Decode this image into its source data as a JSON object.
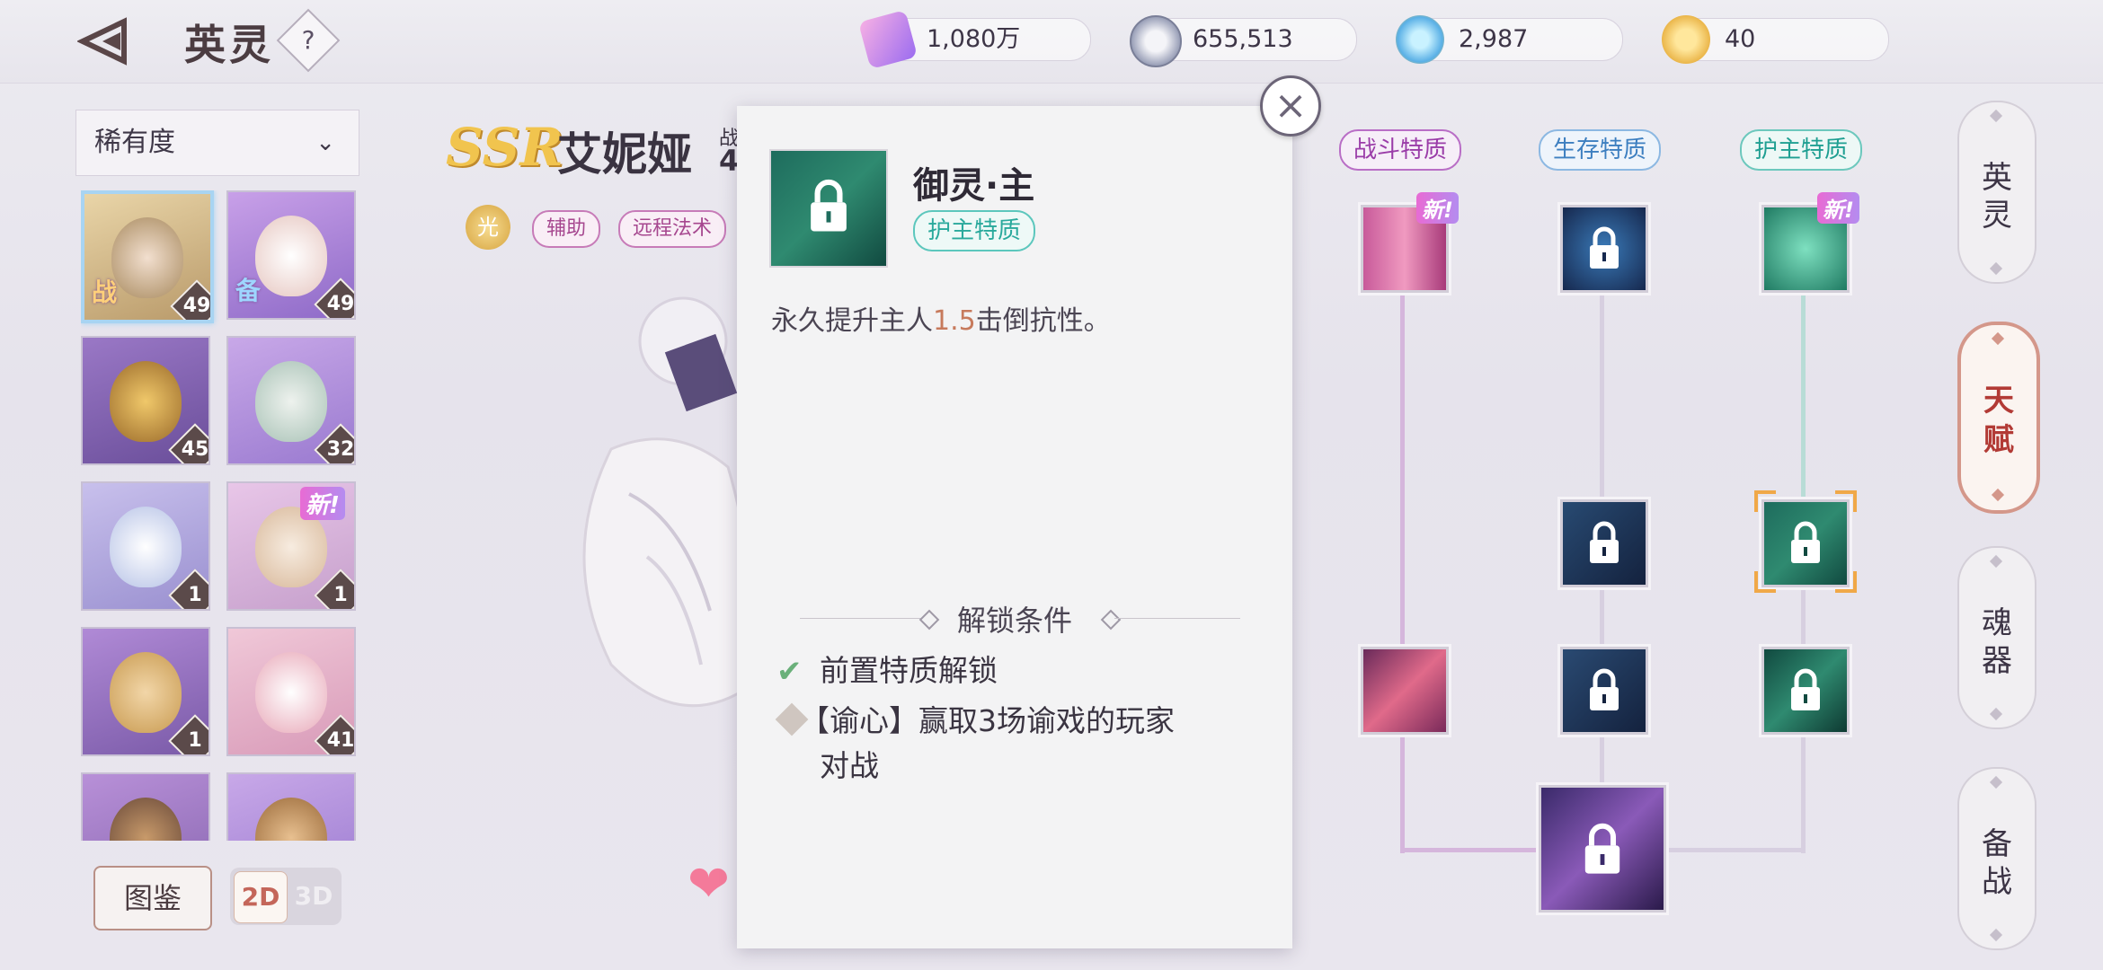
{
  "header": {
    "title": "英灵",
    "help_label": "?",
    "resources": [
      {
        "icon": "ticket-icon",
        "value": "1,080万"
      },
      {
        "icon": "silver-coin-icon",
        "value": "655,513"
      },
      {
        "icon": "diamond-coin-icon",
        "value": "2,987"
      },
      {
        "icon": "gold-token-icon",
        "value": "40"
      }
    ]
  },
  "left_panel": {
    "filter_label": "稀有度",
    "cards": [
      {
        "level": "49",
        "tag": "战",
        "new": false
      },
      {
        "level": "49",
        "tag": "备",
        "new": false
      },
      {
        "level": "45",
        "tag": "",
        "new": false
      },
      {
        "level": "32",
        "tag": "",
        "new": false
      },
      {
        "level": "1",
        "tag": "",
        "new": false
      },
      {
        "level": "1",
        "tag": "",
        "new": true
      },
      {
        "level": "1",
        "tag": "",
        "new": false
      },
      {
        "level": "41",
        "tag": "",
        "new": false
      },
      {
        "level": "",
        "tag": "",
        "new": false
      },
      {
        "level": "",
        "tag": "",
        "new": false
      }
    ],
    "new_label": "新!",
    "codex_button": "图鉴",
    "view_toggle": {
      "on": "2D",
      "off": "3D"
    }
  },
  "hero": {
    "rarity": "SSR",
    "name": "艾妮娅",
    "power_label": "战",
    "power_value": "4",
    "element": "光",
    "tags": [
      "辅助",
      "远程法术"
    ]
  },
  "popup": {
    "title": "御灵·主",
    "tag": "护主特质",
    "desc_before": "永久提升主人",
    "desc_num": "1.5",
    "desc_after": "击倒抗性。",
    "unlock_title": "解锁条件",
    "conditions": [
      {
        "text": "前置特质解锁",
        "done": true
      },
      {
        "text": "【谕心】赢取3场谕戏的玩家",
        "text2": "对战",
        "done": false
      }
    ],
    "close_label": "×"
  },
  "talent_tree": {
    "headers": [
      "战斗特质",
      "生存特质",
      "护主特质"
    ],
    "new_label": "新!"
  },
  "right_nav": {
    "items": [
      {
        "line1": "英",
        "line2": "灵"
      },
      {
        "line1": "天",
        "line2": "赋"
      },
      {
        "line1": "魂",
        "line2": "器"
      },
      {
        "line1": "备",
        "line2": "战"
      }
    ],
    "active_index": 1
  },
  "colors": {
    "combat": "#b04ec2",
    "survival": "#4a8fd0",
    "guard": "#25a99b",
    "accent": "#c4665a"
  }
}
